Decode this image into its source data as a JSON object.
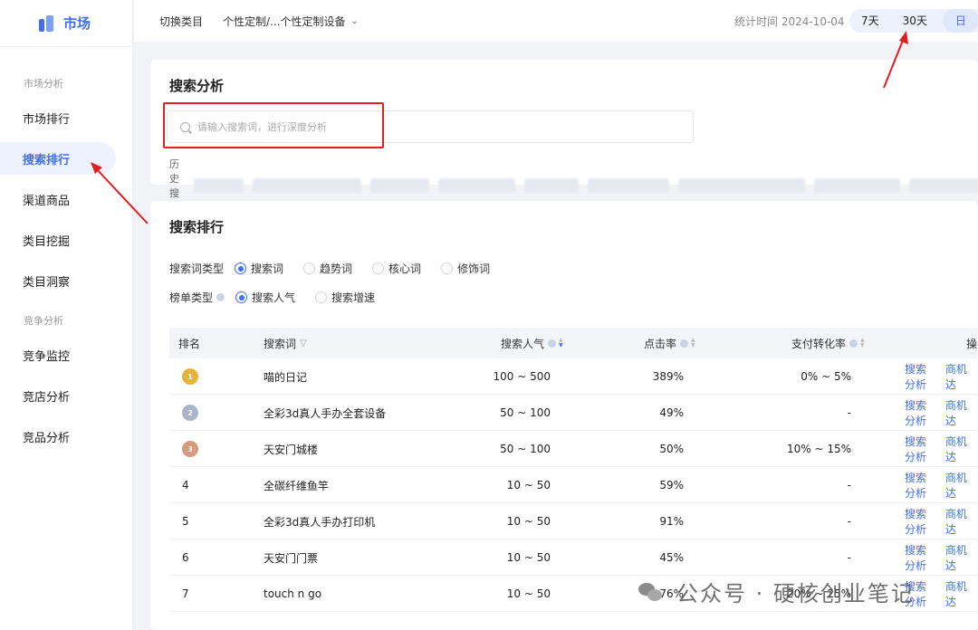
{
  "sidebar": {
    "logo": "市场",
    "group1": "市场分析",
    "items1": [
      "市场排行",
      "搜索排行",
      "渠道商品",
      "类目挖掘",
      "类目洞察"
    ],
    "group2": "竞争分析",
    "items2": [
      "竞争监控",
      "竞店分析",
      "竞品分析"
    ]
  },
  "header": {
    "switch_category": "切换类目",
    "category": "个性定制/...个性定制设备",
    "stat_time": "统计时间 2024-10-04",
    "ranges": [
      "7天",
      "30天",
      "日"
    ]
  },
  "search_card": {
    "title": "搜索分析",
    "placeholder": "请输入搜索词，进行深度分析",
    "history_label": "历史搜索:"
  },
  "rank_card": {
    "title": "搜索排行",
    "word_type_label": "搜索词类型",
    "word_types": [
      "搜索词",
      "趋势词",
      "核心词",
      "修饰词"
    ],
    "list_type_label": "榜单类型",
    "list_types": [
      "搜索人气",
      "搜索增速"
    ],
    "columns": [
      "排名",
      "搜索词",
      "搜索人气",
      "点击率",
      "支付转化率",
      "操"
    ],
    "rows": [
      {
        "rank": "1",
        "word": "喵的日记",
        "popularity": "100 ~ 500",
        "ctr": "389%",
        "pay": "0% ~ 5%"
      },
      {
        "rank": "2",
        "word": "全彩3d真人手办全套设备",
        "popularity": "50 ~ 100",
        "ctr": "49%",
        "pay": "-"
      },
      {
        "rank": "3",
        "word": "天安门城楼",
        "popularity": "50 ~ 100",
        "ctr": "50%",
        "pay": "10% ~ 15%"
      },
      {
        "rank": "4",
        "word": "全碳纤维鱼竿",
        "popularity": "10 ~ 50",
        "ctr": "59%",
        "pay": "-"
      },
      {
        "rank": "5",
        "word": "全彩3d真人手办打印机",
        "popularity": "10 ~ 50",
        "ctr": "91%",
        "pay": "-"
      },
      {
        "rank": "6",
        "word": "天安门门票",
        "popularity": "10 ~ 50",
        "ctr": "45%",
        "pay": "-"
      },
      {
        "rank": "7",
        "word": "touch n go",
        "popularity": "10 ~ 50",
        "ctr": "76%",
        "pay": "20% ~ 25%"
      }
    ],
    "action1": "搜索分析",
    "action2": "商机达"
  },
  "watermark": "公众号 · 硬核创业笔记",
  "colors": {
    "accent": "#3f6ff0",
    "annotation": "#e02020"
  }
}
